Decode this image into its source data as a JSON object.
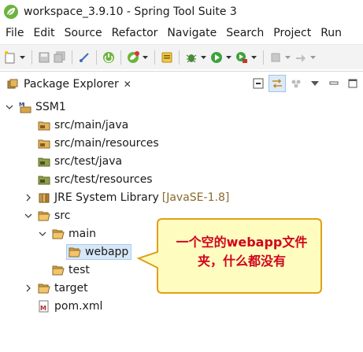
{
  "window": {
    "title": "workspace_3.9.10 - Spring Tool Suite 3",
    "app_icon": "spring-leaf-icon"
  },
  "menubar": {
    "items": [
      "File",
      "Edit",
      "Source",
      "Refactor",
      "Navigate",
      "Search",
      "Project",
      "Run"
    ]
  },
  "toolbar": {
    "buttons": [
      "new-icon",
      "save-icon",
      "save-all-icon",
      "print-icon",
      "toggle-breakpoint-icon",
      "spring-boot-icon",
      "spring-project-icon",
      "open-task-icon",
      "debug-icon",
      "run-icon",
      "external-tools-icon",
      "stop-icon",
      "build-icon"
    ]
  },
  "view": {
    "tab_title": "Package Explorer",
    "tab_close": "✕"
  },
  "tree": {
    "project": "SSM1",
    "items": [
      {
        "label": "src/main/java",
        "icon": "source-folder-icon"
      },
      {
        "label": "src/main/resources",
        "icon": "source-folder-icon"
      },
      {
        "label": "src/test/java",
        "icon": "source-folder-icon"
      },
      {
        "label": "src/test/resources",
        "icon": "source-folder-icon"
      },
      {
        "label": "JRE System Library",
        "decoration": "[JavaSE-1.8]",
        "icon": "library-icon"
      },
      {
        "label": "src",
        "icon": "folder-icon"
      },
      {
        "label": "main",
        "icon": "folder-icon"
      },
      {
        "label": "webapp",
        "icon": "folder-icon",
        "selected": true
      },
      {
        "label": "test",
        "icon": "folder-icon"
      },
      {
        "label": "target",
        "icon": "folder-icon"
      },
      {
        "label": "pom.xml",
        "icon": "maven-file-icon"
      }
    ]
  },
  "callout": {
    "text_before": "一个空的",
    "text_bold": "webapp",
    "text_after": "文件夹，什么都没有",
    "color": "#d0021b",
    "fill": "#fffcc0",
    "border": "#e0a01a"
  }
}
